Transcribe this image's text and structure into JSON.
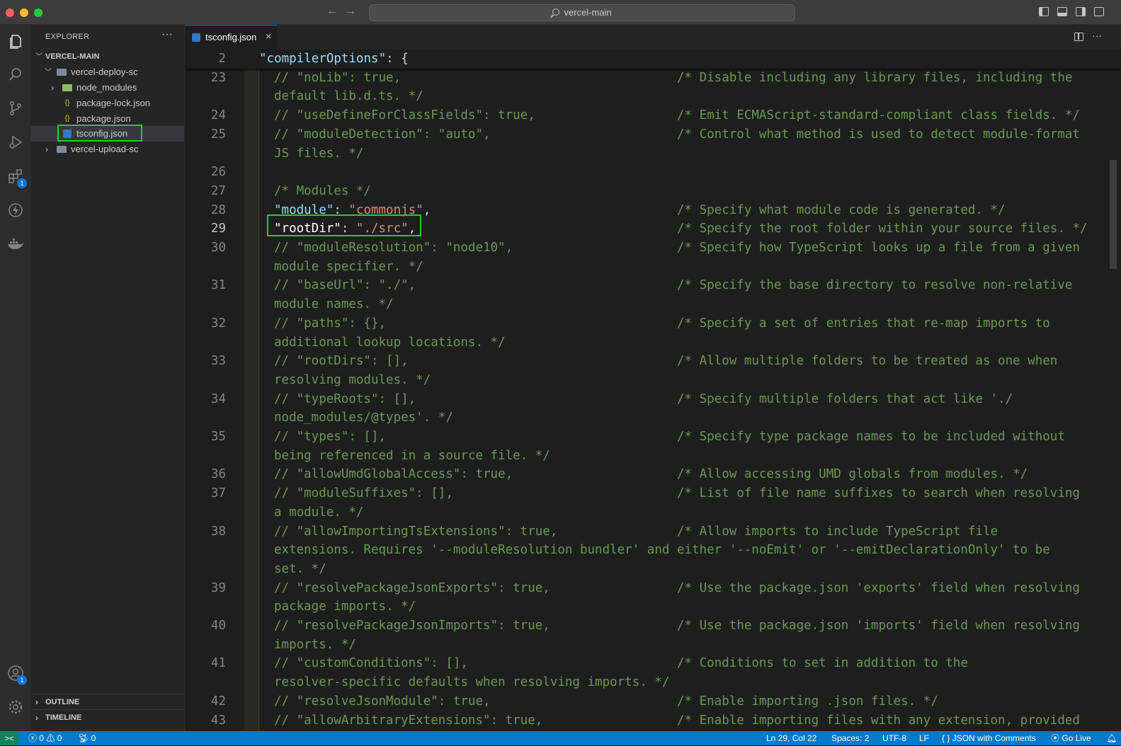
{
  "window": {
    "search_text": "vercel-main"
  },
  "sidebar": {
    "title": "EXPLORER",
    "more": "···",
    "root": "VERCEL-MAIN",
    "items": [
      {
        "label": "vercel-deploy-sc",
        "kind": "folder",
        "expanded": true
      },
      {
        "label": "node_modules",
        "kind": "folder"
      },
      {
        "label": "package-lock.json",
        "kind": "json"
      },
      {
        "label": "package.json",
        "kind": "json"
      },
      {
        "label": "tsconfig.json",
        "kind": "tsconfig",
        "selected": true
      },
      {
        "label": "vercel-upload-sc",
        "kind": "folder"
      }
    ],
    "outline": "OUTLINE",
    "timeline": "TIMELINE"
  },
  "activity": {
    "extensions_badge": "1",
    "accounts_badge": "1"
  },
  "editor": {
    "tab_label": "tsconfig.json",
    "tab_close": "×",
    "sticky": {
      "line": "2",
      "key": "\"compilerOptions\"",
      "rest": ": {"
    },
    "lines": [
      {
        "n": "23",
        "code": "// \"noLib\": true,",
        "comment": "/* Disable including any library files, including the",
        "cont": "default lib.d.ts. */"
      },
      {
        "n": "24",
        "code": "// \"useDefineForClassFields\": true,",
        "comment": "/* Emit ECMAScript-standard-compliant class fields. */"
      },
      {
        "n": "25",
        "code": "// \"moduleDetection\": \"auto\",",
        "comment": "/* Control what method is used to detect module-format",
        "cont": "JS files. */"
      },
      {
        "n": "26",
        "code": ""
      },
      {
        "n": "27",
        "code": "/* Modules */"
      },
      {
        "n": "28",
        "key": "\"module\"",
        "value": "\"commonjs\"",
        "comment": "/* Specify what module code is generated. */"
      },
      {
        "n": "29",
        "key": "\"rootDir\"",
        "value": "\"./src\"",
        "comment": "/* Specify the root folder within your source files. */",
        "current": true
      },
      {
        "n": "30",
        "code": "// \"moduleResolution\": \"node10\",",
        "comment": "/* Specify how TypeScript looks up a file from a given",
        "cont": "module specifier. */"
      },
      {
        "n": "31",
        "code": "// \"baseUrl\": \"./\",",
        "comment": "/* Specify the base directory to resolve non-relative",
        "cont": "module names. */"
      },
      {
        "n": "32",
        "code": "// \"paths\": {},",
        "comment": "/* Specify a set of entries that re-map imports to",
        "cont": "additional lookup locations. */"
      },
      {
        "n": "33",
        "code": "// \"rootDirs\": [],",
        "comment": "/* Allow multiple folders to be treated as one when",
        "cont": "resolving modules. */"
      },
      {
        "n": "34",
        "code": "// \"typeRoots\": [],",
        "comment": "/* Specify multiple folders that act like './",
        "cont": "node_modules/@types'. */"
      },
      {
        "n": "35",
        "code": "// \"types\": [],",
        "comment": "/* Specify type package names to be included without",
        "cont": "being referenced in a source file. */"
      },
      {
        "n": "36",
        "code": "// \"allowUmdGlobalAccess\": true,",
        "comment": "/* Allow accessing UMD globals from modules. */"
      },
      {
        "n": "37",
        "code": "// \"moduleSuffixes\": [],",
        "comment": "/* List of file name suffixes to search when resolving",
        "cont": "a module. */"
      },
      {
        "n": "38",
        "code": "// \"allowImportingTsExtensions\": true,",
        "comment": "/* Allow imports to include TypeScript file",
        "cont": "extensions. Requires '--moduleResolution bundler' and either '--noEmit' or '--emitDeclarationOnly' to be",
        "cont2": "set. */"
      },
      {
        "n": "39",
        "code": "// \"resolvePackageJsonExports\": true,",
        "comment": "/* Use the package.json 'exports' field when resolving",
        "cont": "package imports. */"
      },
      {
        "n": "40",
        "code": "// \"resolvePackageJsonImports\": true,",
        "comment": "/* Use the package.json 'imports' field when resolving",
        "cont": "imports. */"
      },
      {
        "n": "41",
        "code": "// \"customConditions\": [],",
        "comment": "/* Conditions to set in addition to the",
        "cont": "resolver-specific defaults when resolving imports. */"
      },
      {
        "n": "42",
        "code": "// \"resolveJsonModule\": true,",
        "comment": "/* Enable importing .json files. */"
      },
      {
        "n": "43",
        "code": "// \"allowArbitraryExtensions\": true,",
        "comment": "/* Enable importing files with any extension, provided"
      }
    ]
  },
  "status": {
    "remote": "><",
    "errors": "0",
    "warnings": "0",
    "ports": "0",
    "position": "Ln 29, Col 22",
    "spaces": "Spaces: 2",
    "encoding": "UTF-8",
    "eol": "LF",
    "language": "JSON with Comments",
    "golive": "Go Live"
  },
  "colors": {
    "accent": "#007acc",
    "highlight": "#1fd11f",
    "comment": "#6a9955",
    "key": "#9cdcfe",
    "string": "#ce9178"
  }
}
